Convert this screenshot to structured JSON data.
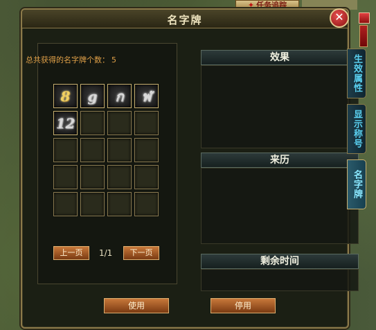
{
  "window": {
    "title": "名字牌"
  },
  "top": {
    "task_tab": "任务追踪"
  },
  "collection": {
    "total_label": "总共获得的名字牌个数：",
    "total_count": "5",
    "items": [
      {
        "glyph": "8",
        "style": "gold"
      },
      {
        "glyph": "g",
        "style": "silver"
      },
      {
        "glyph": "ก",
        "style": "silver"
      },
      {
        "glyph": "ฬ",
        "style": "silver"
      },
      {
        "glyph": "12",
        "style": "silver"
      }
    ],
    "rows": 5,
    "cols": 4
  },
  "pager": {
    "prev": "上一页",
    "next": "下一页",
    "indicator": "1/1"
  },
  "sections": {
    "effect": "效果",
    "origin": "来历",
    "remaining": "剩余时间"
  },
  "side_tabs": [
    "生效属性",
    "显示称号",
    "名字牌"
  ],
  "actions": {
    "use": "使用",
    "stop": "停用"
  }
}
